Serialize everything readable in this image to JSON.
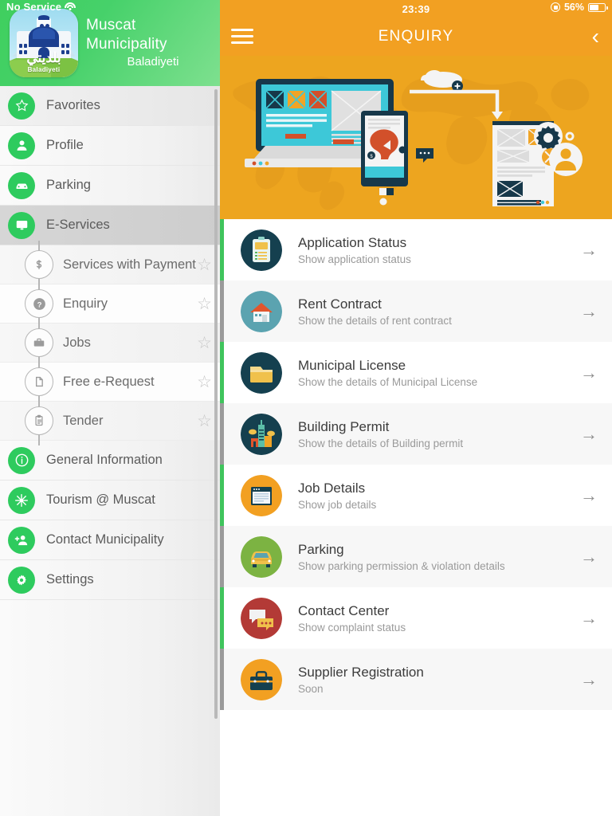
{
  "status_bar": {
    "carrier": "No Service",
    "wifi_icon": "wifi-icon",
    "time": "23:39",
    "battery_percent": "56%",
    "lock_icon": "rotation-lock-icon",
    "battery_icon": "battery-icon"
  },
  "sidebar": {
    "brand_title": "Muscat Municipality",
    "brand_subtitle": "Baladiyeti",
    "logo": {
      "arabic_text": "بلديتي",
      "latin_text": "Baladiyeti",
      "icon": "muscat-municipality-logo"
    },
    "items": [
      {
        "label": "Favorites",
        "icon": "star-icon",
        "active": false
      },
      {
        "label": "Profile",
        "icon": "person-icon",
        "active": false
      },
      {
        "label": "Parking",
        "icon": "car-icon",
        "active": false
      },
      {
        "label": "E-Services",
        "icon": "monitor-icon",
        "active": true
      }
    ],
    "sub_items": [
      {
        "label": "Services with Payment",
        "icon": "dollar-icon",
        "favorite_icon": "star-outline-icon"
      },
      {
        "label": "Enquiry",
        "icon": "question-icon",
        "favorite_icon": "star-outline-icon"
      },
      {
        "label": "Jobs",
        "icon": "briefcase-icon",
        "favorite_icon": "star-outline-icon"
      },
      {
        "label": "Free e-Request",
        "icon": "document-icon",
        "favorite_icon": "star-outline-icon"
      },
      {
        "label": "Tender",
        "icon": "clipboard-icon",
        "favorite_icon": "star-outline-icon"
      }
    ],
    "items_bottom": [
      {
        "label": "General Information",
        "icon": "info-icon"
      },
      {
        "label": "Tourism @ Muscat",
        "icon": "sun-burst-icon"
      },
      {
        "label": "Contact Municipality",
        "icon": "add-person-icon"
      },
      {
        "label": "Settings",
        "icon": "gear-icon"
      }
    ]
  },
  "navbar": {
    "menu_icon": "hamburger-icon",
    "title": "ENQUIRY",
    "back_icon": "chevron-left-icon"
  },
  "banner": {
    "alt": "e-services flat illustration with desktop monitor, tablet, document and world map"
  },
  "list": {
    "arrow_icon": "arrow-right-icon",
    "items": [
      {
        "title": "Application Status",
        "subtitle": "Show application status",
        "icon": "clipboard-checklist-icon"
      },
      {
        "title": "Rent Contract",
        "subtitle": "Show the details of rent contract",
        "icon": "house-icon"
      },
      {
        "title": "Municipal License",
        "subtitle": "Show the details of Municipal License",
        "icon": "folder-icon"
      },
      {
        "title": "Building Permit",
        "subtitle": "Show the details of Building permit",
        "icon": "city-buildings-icon"
      },
      {
        "title": "Job Details",
        "subtitle": "Show job details",
        "icon": "browser-window-icon"
      },
      {
        "title": "Parking",
        "subtitle": "Show parking permission & violation details",
        "icon": "car-front-icon"
      },
      {
        "title": "Contact Center",
        "subtitle": "Show complaint status",
        "icon": "chat-bubbles-icon"
      },
      {
        "title": "Supplier Registration",
        "subtitle": "Soon",
        "icon": "suitcase-icon"
      }
    ]
  },
  "colors": {
    "accent_orange": "#f2a022",
    "brand_green": "#2ecb5e",
    "edge_green": "#3fc45c",
    "edge_gray": "#9a9a9a"
  }
}
